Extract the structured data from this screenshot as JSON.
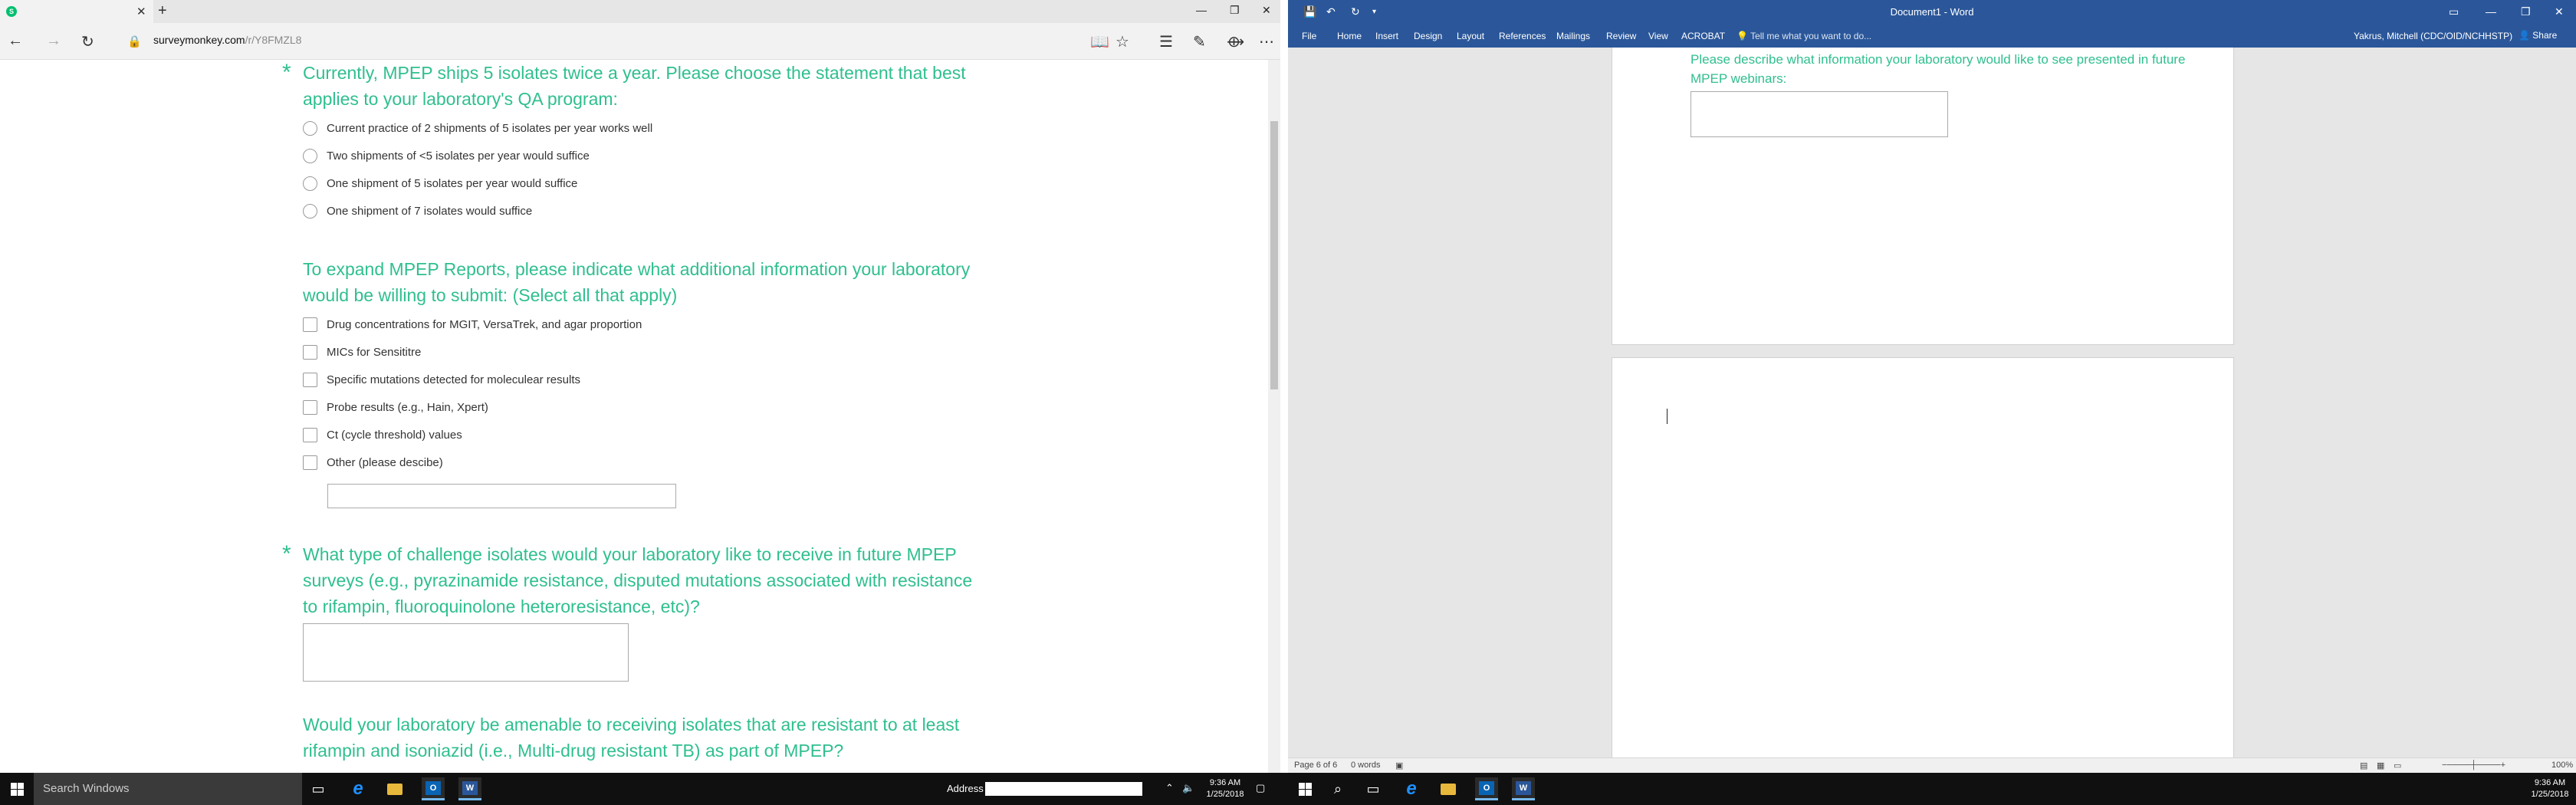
{
  "browser": {
    "tab_icon_text": "S",
    "url_host": "surveymonkey.com",
    "url_path": "/r/Y8FMZL8"
  },
  "survey": {
    "q1": {
      "required_mark": "*",
      "title": "Currently, MPEP ships 5 isolates twice a year. Please choose the statement that best applies to your laboratory's QA program:",
      "options": [
        "Current practice of 2 shipments of 5 isolates per year works well",
        "Two shipments of <5 isolates per year would suffice",
        "One shipment of 5 isolates per year would suffice",
        "One shipment of 7 isolates would suffice"
      ]
    },
    "q2": {
      "title": "To expand MPEP Reports, please indicate what additional information your laboratory would be willing to submit: (Select all that apply)",
      "options": [
        "Drug concentrations for MGIT, VersaTrek, and agar proportion",
        "MICs for Sensititre",
        "Specific mutations detected for moleculear results",
        "Probe results (e.g., Hain, Xpert)",
        "Ct (cycle threshold) values",
        "Other (please descibe)"
      ]
    },
    "q3": {
      "required_mark": "*",
      "title": "What type of challenge isolates would your laboratory like to receive in future MPEP surveys (e.g., pyrazinamide resistance, disputed mutations associated with resistance to rifampin, fluoroquinolone heteroresistance, etc)?"
    },
    "q4": {
      "title": "Would your laboratory be amenable to receiving isolates that are resistant to at least rifampin and isoniazid (i.e., Multi-drug resistant TB) as part of MPEP?"
    }
  },
  "taskbar_left": {
    "search_placeholder": "Search Windows",
    "address_label": "Address",
    "time": "9:36 AM",
    "date": "1/25/2018"
  },
  "word": {
    "window_title": "Document1 - Word",
    "ribbon_tabs": [
      "File",
      "Home",
      "Insert",
      "Design",
      "Layout",
      "References",
      "Mailings",
      "Review",
      "View",
      "ACROBAT"
    ],
    "tell_me": "Tell me what you want to do...",
    "user": "Yakrus, Mitchell (CDC/OID/NCHHSTP)",
    "share": "Share",
    "doc_text": "Please describe what information your laboratory would like to see presented in future MPEP webinars:",
    "status_page": "Page 6 of 6",
    "status_words": "0 words",
    "zoom": "100%"
  },
  "taskbar_right": {
    "time": "9:36 AM",
    "date": "1/25/2018"
  },
  "colors": {
    "survey_green": "#2fbf8f",
    "word_blue": "#2b579a",
    "taskbar": "#101010"
  }
}
